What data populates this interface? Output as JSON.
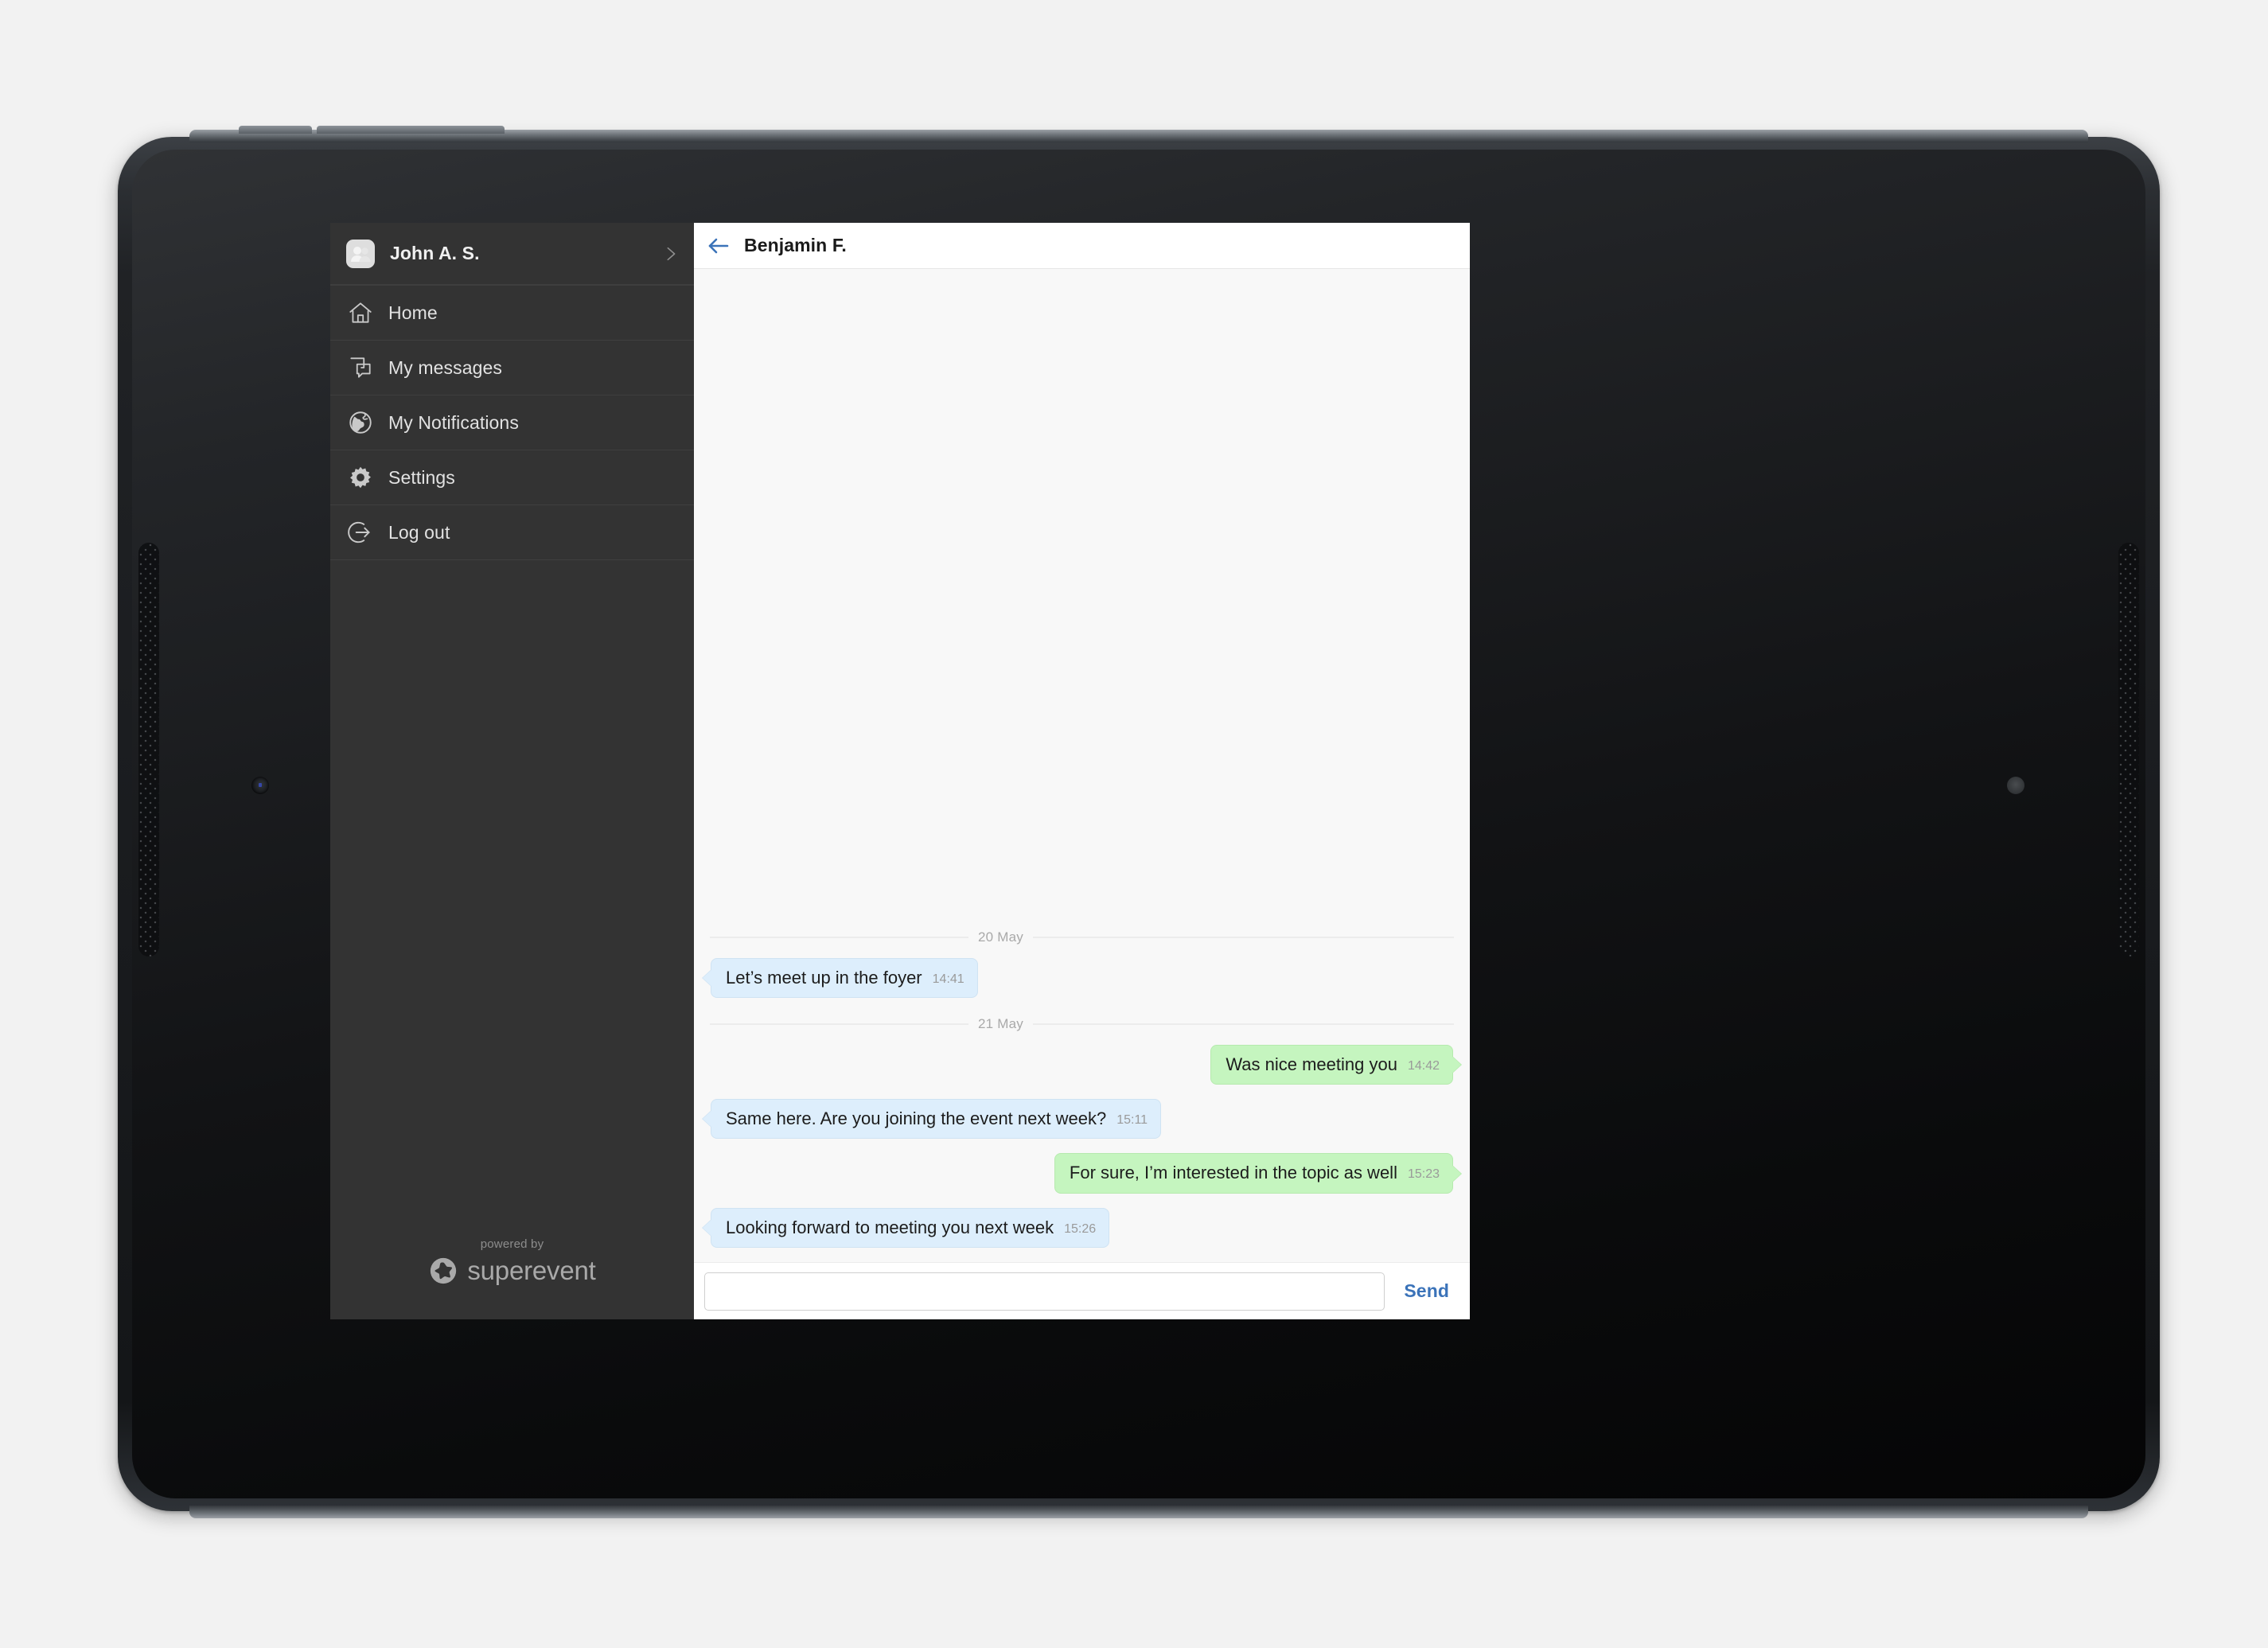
{
  "sidebar": {
    "account": {
      "name": "John A. S.",
      "avatar_icon": "contacts-avatar-icon",
      "chevron_icon": "chevron-right-icon"
    },
    "items": [
      {
        "label": "Home",
        "icon": "home-icon"
      },
      {
        "label": "My messages",
        "icon": "chat-bubbles-icon"
      },
      {
        "label": "My Notifications",
        "icon": "globe-icon"
      },
      {
        "label": "Settings",
        "icon": "gear-icon"
      },
      {
        "label": "Log out",
        "icon": "logout-arrow-icon"
      }
    ],
    "footer": {
      "kicker": "powered by",
      "brand": "superevent",
      "mark_icon": "superevent-star-icon"
    }
  },
  "chat": {
    "back_icon": "back-arrow-icon",
    "title": "Benjamin F.",
    "groups": [
      {
        "date": "20 May",
        "messages": [
          {
            "dir": "in",
            "text": "Let’s meet up in the foyer",
            "time": "14:41"
          }
        ]
      },
      {
        "date": "21 May",
        "messages": [
          {
            "dir": "out",
            "text": "Was nice meeting you",
            "time": "14:42"
          },
          {
            "dir": "in",
            "text": "Same here. Are you joining the event next week?",
            "time": "15:11"
          },
          {
            "dir": "out",
            "text": "For sure, I’m interested in the topic as well",
            "time": "15:23"
          },
          {
            "dir": "in",
            "text": "Looking forward to meeting you next week",
            "time": "15:26"
          }
        ]
      }
    ],
    "compose": {
      "value": "",
      "placeholder": "",
      "send_label": "Send"
    }
  },
  "colors": {
    "sidebar_bg": "#333333",
    "accent_blue": "#3b73b9",
    "bubble_in": "#ddeefc",
    "bubble_out": "#c5f5bf",
    "chat_bg": "#f8f8f8",
    "page_bg": "#f2f2f2"
  }
}
